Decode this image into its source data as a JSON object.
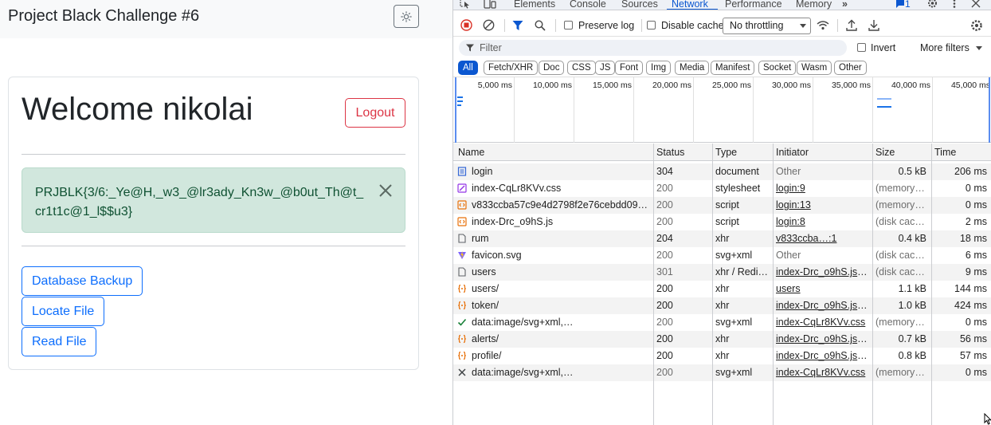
{
  "app": {
    "title": "Project Black Challenge #6",
    "theme_icon": "sun-icon",
    "welcome": "Welcome nikolai",
    "logout_label": "Logout",
    "flag": "PRJBLK{3/6:_Ye@H,_w3_@lr3ady_Kn3w_@b0ut_Th@t_cr1t1c@1_l$$u3}",
    "buttons": [
      "Database Backup",
      "Locate File",
      "Read File"
    ]
  },
  "devtools": {
    "tabs": [
      "Elements",
      "Console",
      "Sources",
      "Network",
      "Performance",
      "Memory"
    ],
    "active_tab": "Network",
    "issues_count": "1",
    "toolbar": {
      "preserve_log": "Preserve log",
      "disable_cache": "Disable cache",
      "throttling": "No throttling"
    },
    "filter": {
      "placeholder": "Filter",
      "invert": "Invert",
      "more_filters": "More filters"
    },
    "type_filters": [
      "All",
      "Fetch/XHR",
      "Doc",
      "CSS",
      "JS",
      "Font",
      "Img",
      "Media",
      "Manifest",
      "Socket",
      "Wasm",
      "Other"
    ],
    "timeline_ticks": [
      "5,000 ms",
      "10,000 ms",
      "15,000 ms",
      "20,000 ms",
      "25,000 ms",
      "30,000 ms",
      "35,000 ms",
      "40,000 ms",
      "45,000 ms"
    ],
    "columns": [
      "Name",
      "Status",
      "Type",
      "Initiator",
      "Size",
      "Time"
    ],
    "rows": [
      {
        "name": "login",
        "status": "304",
        "type": "document",
        "initiator": "Other",
        "size": "0.5 kB",
        "time": "206 ms",
        "icon": "document-icon",
        "dim": false,
        "init_link": false,
        "size_muted": false
      },
      {
        "name": "index-CqLr8KVv.css",
        "status": "200",
        "type": "stylesheet",
        "initiator": "login:9",
        "size": "(memory …",
        "time": "0 ms",
        "icon": "stylesheet-icon",
        "dim": true,
        "init_link": true,
        "size_muted": true
      },
      {
        "name": "v833ccba57c9e4d2798f2e76cebdd09a…",
        "status": "200",
        "type": "script",
        "initiator": "login:13",
        "size": "(memory …",
        "time": "0 ms",
        "icon": "script-icon",
        "dim": true,
        "init_link": true,
        "size_muted": true
      },
      {
        "name": "index-Drc_o9hS.js",
        "status": "200",
        "type": "script",
        "initiator": "login:8",
        "size": "(disk cache)",
        "time": "2 ms",
        "icon": "script-icon",
        "dim": true,
        "init_link": true,
        "size_muted": true
      },
      {
        "name": "rum",
        "status": "204",
        "type": "xhr",
        "initiator": "v833ccba…:1",
        "size": "0.4 kB",
        "time": "18 ms",
        "icon": "file-icon",
        "dim": false,
        "init_link": true,
        "size_muted": false
      },
      {
        "name": "favicon.svg",
        "status": "200",
        "type": "svg+xml",
        "initiator": "Other",
        "size": "(disk cache)",
        "time": "6 ms",
        "icon": "vite-icon",
        "dim": true,
        "init_link": false,
        "size_muted": true
      },
      {
        "name": "users",
        "status": "301",
        "type": "xhr / Redir…",
        "initiator": "index-Drc_o9hS.js:50",
        "size": "(disk cache)",
        "time": "9 ms",
        "icon": "file-icon",
        "dim": true,
        "init_link": true,
        "size_muted": true
      },
      {
        "name": "users/",
        "status": "200",
        "type": "xhr",
        "initiator": "users",
        "size": "1.1 kB",
        "time": "144 ms",
        "icon": "xhr-icon",
        "dim": false,
        "init_link": true,
        "size_muted": false
      },
      {
        "name": "token/",
        "status": "200",
        "type": "xhr",
        "initiator": "index-Drc_o9hS.js:50",
        "size": "1.0 kB",
        "time": "424 ms",
        "icon": "xhr-icon",
        "dim": false,
        "init_link": true,
        "size_muted": false
      },
      {
        "name": "data:image/svg+xml,…",
        "status": "200",
        "type": "svg+xml",
        "initiator": "index-CqLr8KVv.css",
        "size": "(memory …",
        "time": "0 ms",
        "icon": "checkmark-icon",
        "dim": true,
        "init_link": true,
        "size_muted": true
      },
      {
        "name": "alerts/",
        "status": "200",
        "type": "xhr",
        "initiator": "index-Drc_o9hS.js:50",
        "size": "0.7 kB",
        "time": "56 ms",
        "icon": "xhr-icon",
        "dim": false,
        "init_link": true,
        "size_muted": false
      },
      {
        "name": "profile/",
        "status": "200",
        "type": "xhr",
        "initiator": "index-Drc_o9hS.js:50",
        "size": "0.8 kB",
        "time": "57 ms",
        "icon": "xhr-icon",
        "dim": false,
        "init_link": true,
        "size_muted": false
      },
      {
        "name": "data:image/svg+xml,…",
        "status": "200",
        "type": "svg+xml",
        "initiator": "index-CqLr8KVv.css",
        "size": "(memory …",
        "time": "0 ms",
        "icon": "x-icon",
        "dim": true,
        "init_link": true,
        "size_muted": true
      }
    ]
  },
  "colors": {
    "primary": "#0d6efd",
    "danger": "#dc3545",
    "success_bg": "#d1e7dd",
    "success_text": "#0f5132",
    "devtools_accent": "#0b57d0",
    "record_red": "#d93025"
  }
}
